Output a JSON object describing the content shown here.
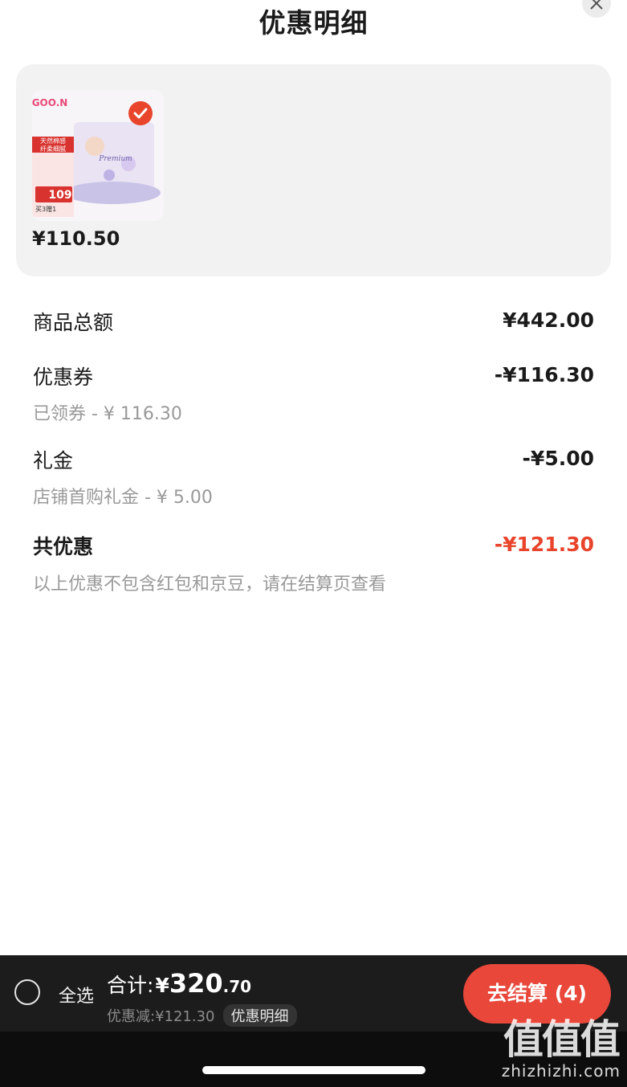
{
  "header": {
    "title": "优惠明细",
    "close_icon": "close-icon"
  },
  "product": {
    "price": "¥110.50",
    "selected": true,
    "image_texts": {
      "brand": "GOO.N",
      "badge_line1": "天然棉感",
      "badge_line2": "纤柔细腻",
      "price_tag": "109",
      "promo": "买3赠1",
      "package": "Premium"
    }
  },
  "summary": {
    "goods_total": {
      "label": "商品总额",
      "amount": "¥442.00"
    },
    "coupon": {
      "label": "优惠券",
      "amount": "-¥116.30",
      "detail": "已领券 - ¥ 116.30"
    },
    "gift_cash": {
      "label": "礼金",
      "amount": "-¥5.00",
      "detail": "店铺首购礼金 - ¥ 5.00"
    },
    "total_discount": {
      "label": "共优惠",
      "amount": "-¥121.30",
      "note": "以上优惠不包含红包和京豆，请在结算页查看"
    }
  },
  "bottom_bar": {
    "select_all": "全选",
    "total_label": "合计:",
    "total_yen": "¥",
    "total_int": "320",
    "total_dec": ".70",
    "saving": "优惠减:¥121.30",
    "detail_link": "优惠明细",
    "checkout": "去结算 (4)"
  },
  "watermark": {
    "logo": "值值值",
    "site": "zhizhizhi.com"
  },
  "colors": {
    "accent_red": "#e8452c",
    "checkout_red": "#e8473a",
    "card_bg": "#f2f2f2",
    "bar_bg": "#1c1c1c"
  }
}
